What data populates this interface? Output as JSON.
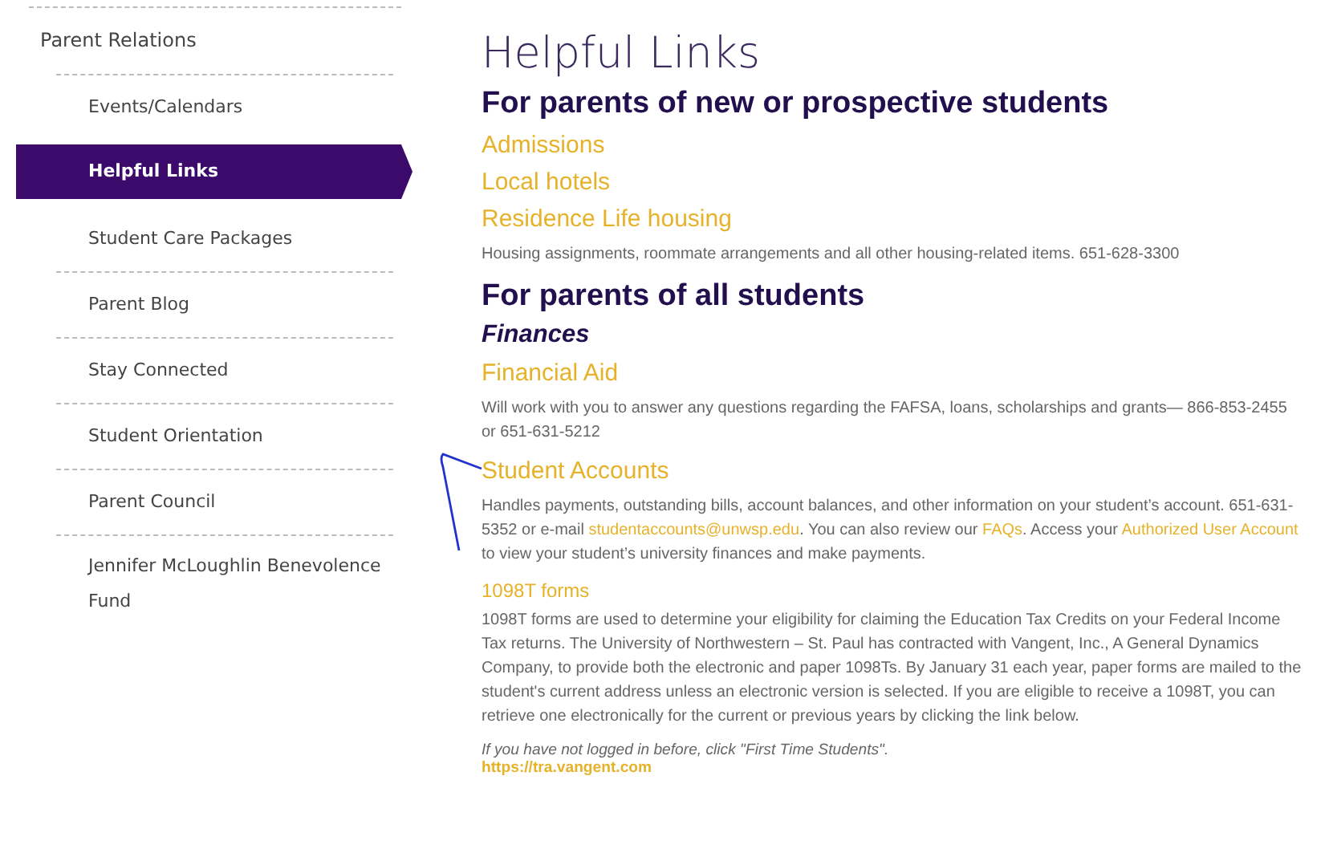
{
  "sidebar": {
    "heading": "Parent Relations",
    "items": [
      {
        "label": "Events/Calendars",
        "selected": false
      },
      {
        "label": "Helpful Links",
        "selected": true
      },
      {
        "label": "Student Care Packages",
        "selected": false
      },
      {
        "label": "Parent Blog",
        "selected": false
      },
      {
        "label": "Stay Connected",
        "selected": false
      },
      {
        "label": "Student Orientation",
        "selected": false
      },
      {
        "label": "Parent Council",
        "selected": false
      },
      {
        "label": "Jennifer McLoughlin Benevolence Fund",
        "selected": false
      }
    ]
  },
  "content": {
    "title": "Helpful Links",
    "blocks": [
      {
        "kind": "section",
        "text": "For parents of new or prospective students"
      },
      {
        "kind": "link",
        "text": "Admissions"
      },
      {
        "kind": "link",
        "text": "Local hotels"
      },
      {
        "kind": "link",
        "text": "Residence Life housing"
      },
      {
        "kind": "paragraph",
        "parts": [
          {
            "kind": "text",
            "text": "Housing assignments, roommate arrangements and all other housing-related items. 651-628-3300"
          }
        ]
      },
      {
        "kind": "section",
        "text": "For parents of all students"
      },
      {
        "kind": "subsection",
        "text": "Finances"
      },
      {
        "kind": "link",
        "text": "Financial Aid"
      },
      {
        "kind": "paragraph",
        "parts": [
          {
            "kind": "text",
            "text": "Will work with you to answer any questions regarding the FAFSA, loans, scholarships and grants— 866-853-2455 or 651-631-5212"
          }
        ]
      },
      {
        "kind": "link",
        "text": "Student Accounts",
        "annotated": true
      },
      {
        "kind": "paragraph",
        "parts": [
          {
            "kind": "text",
            "text": "Handles payments, outstanding bills, account balances, and other information on your student’s account. 651-631-5352 or e-mail "
          },
          {
            "kind": "link",
            "text": "studentaccounts@unwsp.edu"
          },
          {
            "kind": "text",
            "text": ". You can also review our "
          },
          {
            "kind": "link",
            "text": "FAQs"
          },
          {
            "kind": "text",
            "text": ".  Access your "
          },
          {
            "kind": "link",
            "text": "Authorized User Account"
          },
          {
            "kind": "text",
            "text": " to view your student’s university finances and make payments."
          }
        ]
      },
      {
        "kind": "minorlink",
        "text": "1098T forms"
      },
      {
        "kind": "paragraph",
        "parts": [
          {
            "kind": "text",
            "text": "1098T forms are used to determine your eligibility for claiming the Education Tax Credits on your Federal Income Tax returns. The University of Northwestern – St. Paul has contracted with Vangent, Inc., A General Dynamics Company, to provide both the electronic and paper 1098Ts. By January 31 each year, paper forms are mailed to the student's current address unless an electronic version is selected. If you are eligible to receive a 1098T, you can retrieve one electronically for the current or previous years by clicking the link below."
          }
        ]
      },
      {
        "kind": "note",
        "text": "If you have not logged in before, click \"First Time Students\"."
      },
      {
        "kind": "url",
        "text": "https://tra.vangent.com"
      }
    ]
  }
}
